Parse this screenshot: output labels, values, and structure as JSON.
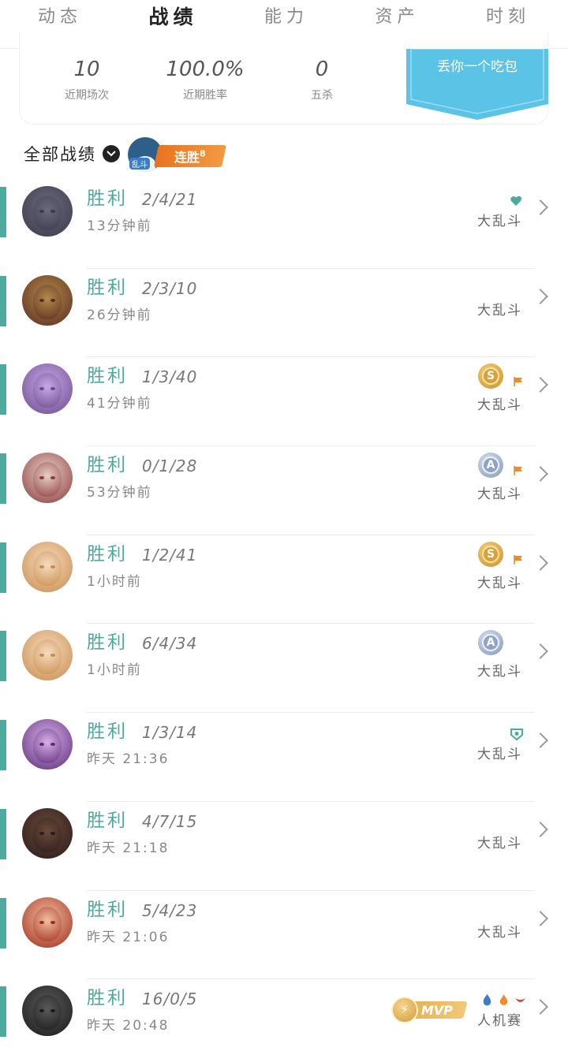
{
  "tabs": [
    {
      "label": "动态",
      "active": false
    },
    {
      "label": "战绩",
      "active": true
    },
    {
      "label": "能力",
      "active": false
    },
    {
      "label": "资产",
      "active": false
    },
    {
      "label": "时刻",
      "active": false
    }
  ],
  "summary": {
    "stats": [
      {
        "value": "10",
        "label": "近期场次"
      },
      {
        "value": "100.0%",
        "label": "近期胜率"
      },
      {
        "value": "0",
        "label": "五杀"
      }
    ],
    "banner_label": "丢你一个吃包"
  },
  "filter": {
    "label": "全部战绩",
    "streak_mode": "乱斗",
    "streak_label": "连胜",
    "streak_count": "8"
  },
  "colors": {
    "win_accent": "#4ea99f",
    "streak_orange": "#e8741f",
    "banner_blue": "#5bc3e6"
  },
  "matches": [
    {
      "result": "胜利",
      "kda": "2/4/21",
      "time": "13分钟前",
      "mode": "大乱斗",
      "badge": "heart-plus-icon",
      "avatar": [
        "#3a3a4a",
        "#6a6a7d"
      ]
    },
    {
      "result": "胜利",
      "kda": "2/3/10",
      "time": "26分钟前",
      "mode": "大乱斗",
      "badge": "",
      "avatar": [
        "#5a2a20",
        "#b38a4a"
      ]
    },
    {
      "result": "胜利",
      "kda": "1/3/40",
      "time": "41分钟前",
      "mode": "大乱斗",
      "badge": "s-rank-coin-icon",
      "coin": "S",
      "flag": true,
      "avatar": [
        "#6a4a8a",
        "#c8a8e8"
      ]
    },
    {
      "result": "胜利",
      "kda": "0/1/28",
      "time": "53分钟前",
      "mode": "大乱斗",
      "badge": "a-rank-coin-icon",
      "coin": "A",
      "flag": true,
      "avatar": [
        "#8a3a3a",
        "#e8d0c8"
      ]
    },
    {
      "result": "胜利",
      "kda": "1/2/41",
      "time": "1小时前",
      "mode": "大乱斗",
      "badge": "s-rank-coin-icon",
      "coin": "S",
      "flag": true,
      "avatar": [
        "#c88a4a",
        "#f6dcc0"
      ]
    },
    {
      "result": "胜利",
      "kda": "6/4/34",
      "time": "1小时前",
      "mode": "大乱斗",
      "badge": "a-rank-coin-icon",
      "coin": "A",
      "flag": false,
      "avatar": [
        "#c88a4a",
        "#f6dcc0"
      ]
    },
    {
      "result": "胜利",
      "kda": "1/3/14",
      "time": "昨天 21:36",
      "mode": "大乱斗",
      "badge": "shield-icon",
      "avatar": [
        "#5a2a7a",
        "#d8b0e8"
      ]
    },
    {
      "result": "胜利",
      "kda": "4/7/15",
      "time": "昨天 21:18",
      "mode": "大乱斗",
      "badge": "",
      "avatar": [
        "#2a1a1a",
        "#6a4a3a"
      ]
    },
    {
      "result": "胜利",
      "kda": "5/4/23",
      "time": "昨天 21:06",
      "mode": "大乱斗",
      "badge": "",
      "avatar": [
        "#a02a1a",
        "#f0c0a0"
      ]
    },
    {
      "result": "胜利",
      "kda": "16/0/5",
      "time": "昨天 20:48",
      "mode": "人机赛",
      "badge": "mvp-icon",
      "mvp_label": "MVP",
      "avatar": [
        "#1a1a1a",
        "#5a5a5a"
      ]
    }
  ]
}
